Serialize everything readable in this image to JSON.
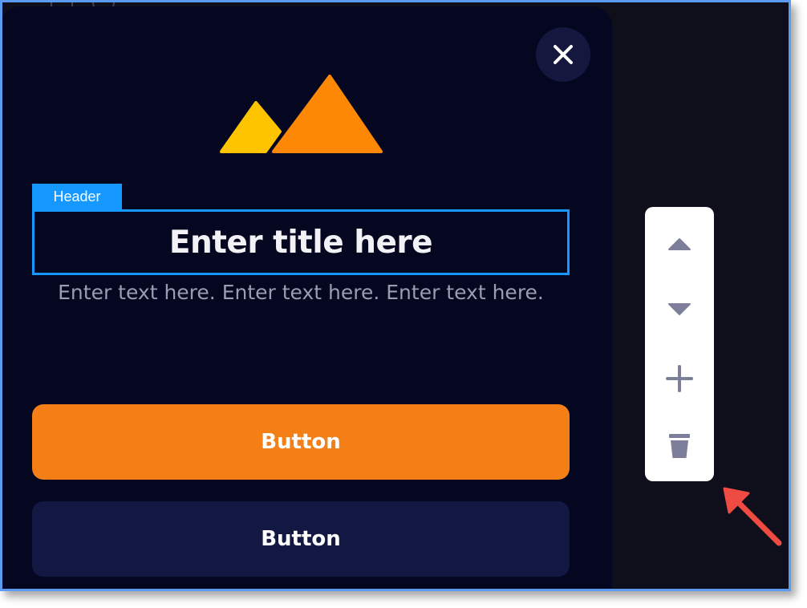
{
  "modal": {
    "header_tag": "Header",
    "title_placeholder": "Enter title here",
    "body_text": "Enter text here. Enter text here. Enter text here.",
    "primary_button": "Button",
    "secondary_button": "Button"
  },
  "toolbar": {
    "actions": [
      "move-up",
      "move-down",
      "add",
      "delete"
    ]
  },
  "icons": {
    "close": "close-icon",
    "logo": "mountains-logo-icon",
    "move_up": "triangle-up-icon",
    "move_down": "triangle-down-icon",
    "add": "plus-icon",
    "delete": "trash-icon",
    "annotation": "red-arrow-icon"
  },
  "colors": {
    "modal_bg": "#050720",
    "accent_blue": "#1598ff",
    "primary_orange": "#f47f17",
    "secondary_navy": "#131843",
    "logo_yellow": "#fec400",
    "logo_orange": "#fd8805",
    "toolbar_icon": "#7d7f9a",
    "arrow_red": "#ee4b43"
  }
}
